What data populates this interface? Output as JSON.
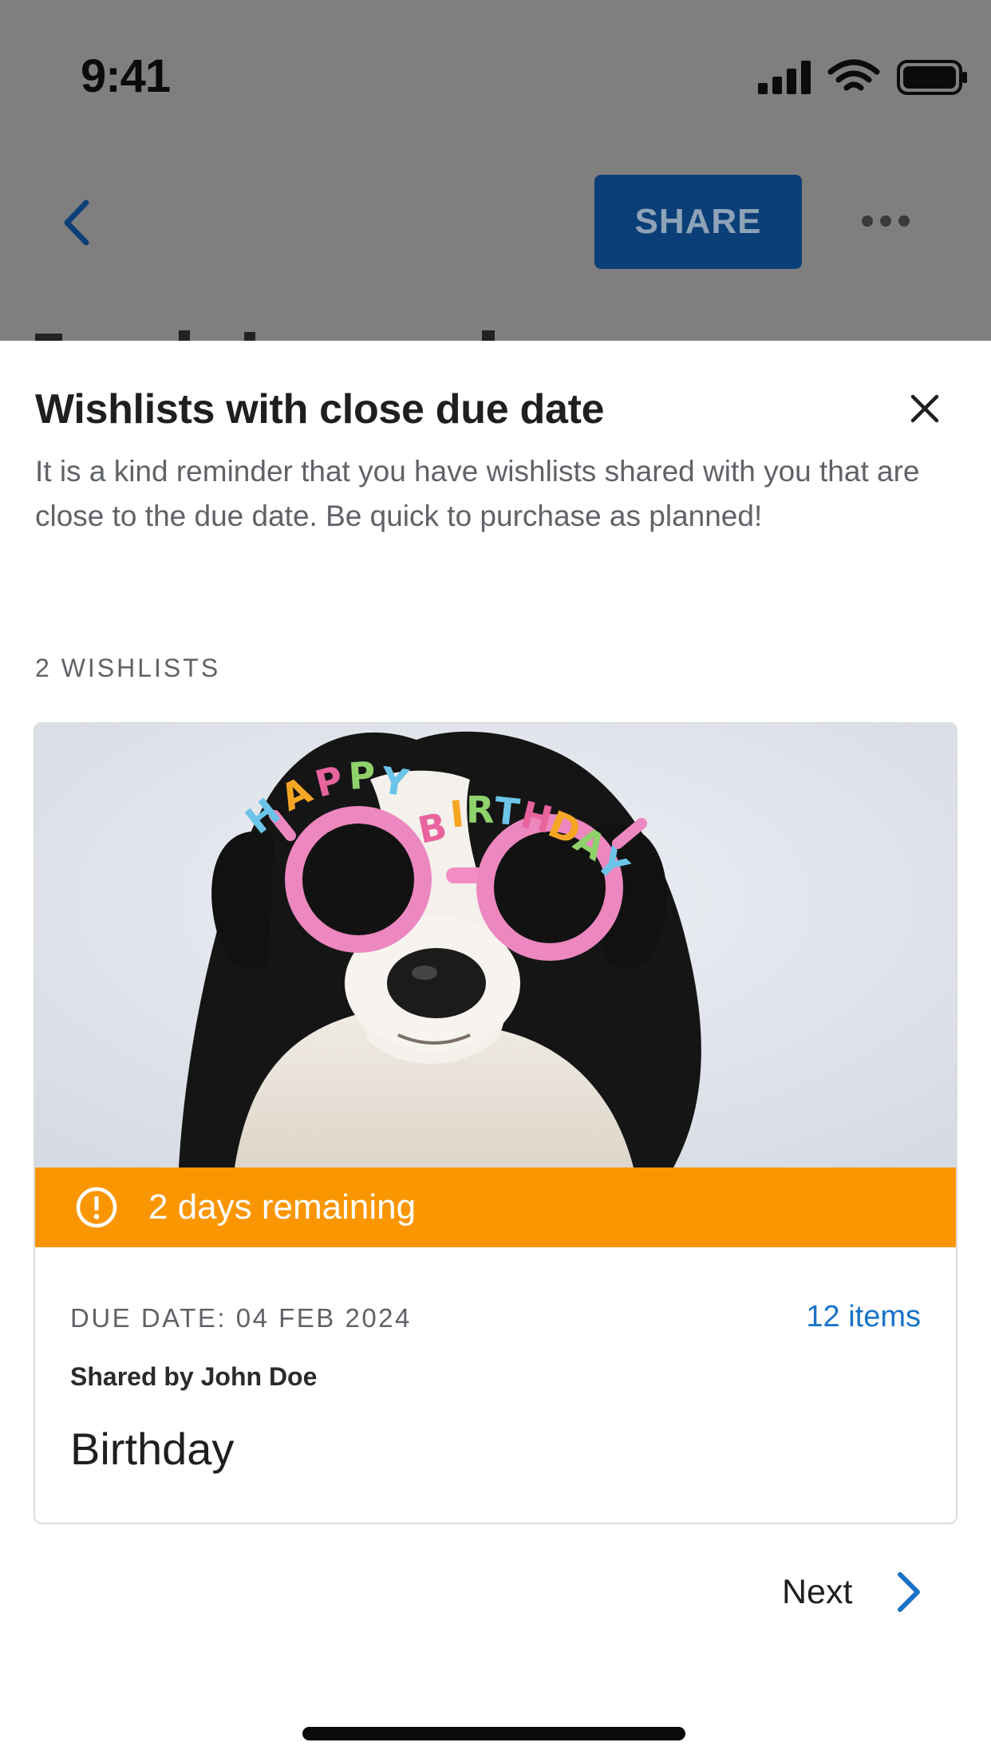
{
  "status_bar": {
    "time": "9:41"
  },
  "background_app": {
    "share_label": "SHARE"
  },
  "sheet": {
    "title": "Wishlists with close due date",
    "description": "It is a kind reminder that you have wishlists shared with you that are close to the due date. Be quick to purchase as planned!",
    "count_label": "2 WISHLISTS"
  },
  "wishlist_card": {
    "image": "dog-with-happy-birthday-glasses",
    "image_lettering": "HAPPY BIRTHDAY",
    "banner_text": "2 days remaining",
    "banner_color": "#fb9603",
    "due_date": "DUE DATE: 04 FEB 2024",
    "items_link": "12 items",
    "shared_by": "Shared by John Doe",
    "title": "Birthday"
  },
  "footer": {
    "next_label": "Next"
  },
  "colors": {
    "accent": "#1a73c7",
    "share_button": "#0b3f77",
    "scrim": "#7f7f7f"
  },
  "icons": {
    "back": "chevron-left-icon",
    "more": "more-horizontal-icon",
    "close": "close-icon",
    "warning": "alert-circle-icon",
    "next": "chevron-right-icon"
  }
}
